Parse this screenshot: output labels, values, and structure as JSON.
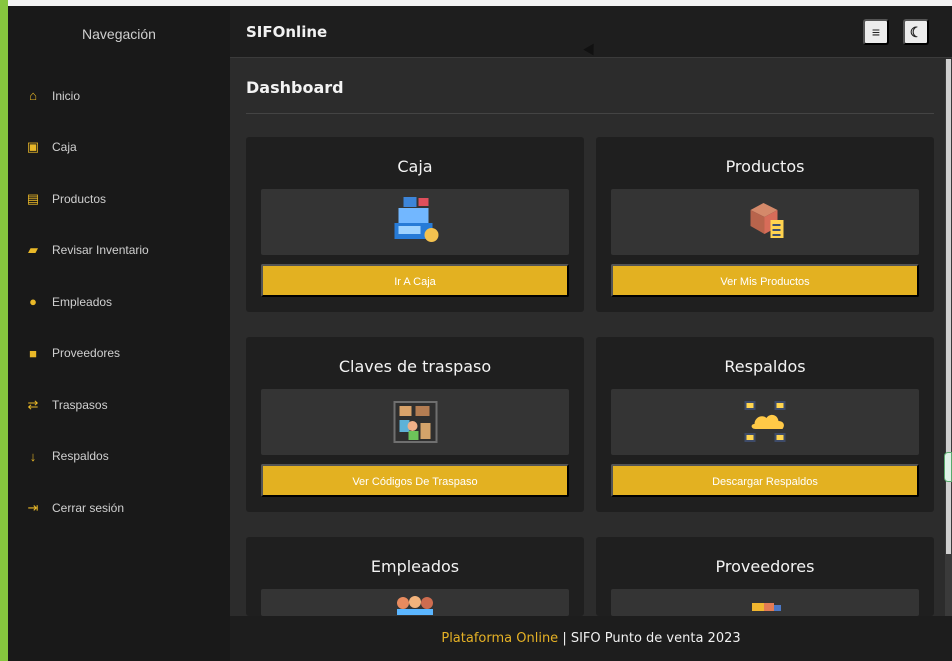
{
  "sidebar": {
    "title": "Navegación",
    "items": [
      {
        "label": "Inicio",
        "icon": "home-icon"
      },
      {
        "label": "Caja",
        "icon": "cash-register-icon"
      },
      {
        "label": "Productos",
        "icon": "warehouse-icon"
      },
      {
        "label": "Revisar Inventario",
        "icon": "boxes-icon"
      },
      {
        "label": "Empleados",
        "icon": "users-icon"
      },
      {
        "label": "Proveedores",
        "icon": "truck-icon"
      },
      {
        "label": "Traspasos",
        "icon": "exchange-icon"
      },
      {
        "label": "Respaldos",
        "icon": "arrow-down-icon"
      },
      {
        "label": "Cerrar sesión",
        "icon": "sign-out-icon"
      }
    ]
  },
  "header": {
    "app_title": "SIFOnline",
    "menu_icon": "hamburger-menu-icon",
    "theme_icon": "moon-icon"
  },
  "page": {
    "title": "Dashboard"
  },
  "cards": [
    {
      "title": "Caja",
      "button": "Ir A Caja",
      "icon": "cash-register-illustration"
    },
    {
      "title": "Productos",
      "button": "Ver Mis Productos",
      "icon": "product-box-clipboard-illustration"
    },
    {
      "title": "Claves de traspaso",
      "button": "Ver Códigos De Traspaso",
      "icon": "warehouse-transfer-illustration"
    },
    {
      "title": "Respaldos",
      "button": "Descargar Respaldos",
      "icon": "cloud-backup-illustration"
    },
    {
      "title": "Empleados",
      "button": "",
      "icon": "employees-illustration"
    },
    {
      "title": "Proveedores",
      "button": "",
      "icon": "supplier-illustration"
    }
  ],
  "footer": {
    "prefix": "Plataforma Online",
    "separator": " | ",
    "suffix": "SIFO Punto de venta 2023"
  },
  "colors": {
    "accent": "#e3b121",
    "sidebar": "#191919",
    "content": "#2c2c2c",
    "card": "#1f1f1f"
  }
}
